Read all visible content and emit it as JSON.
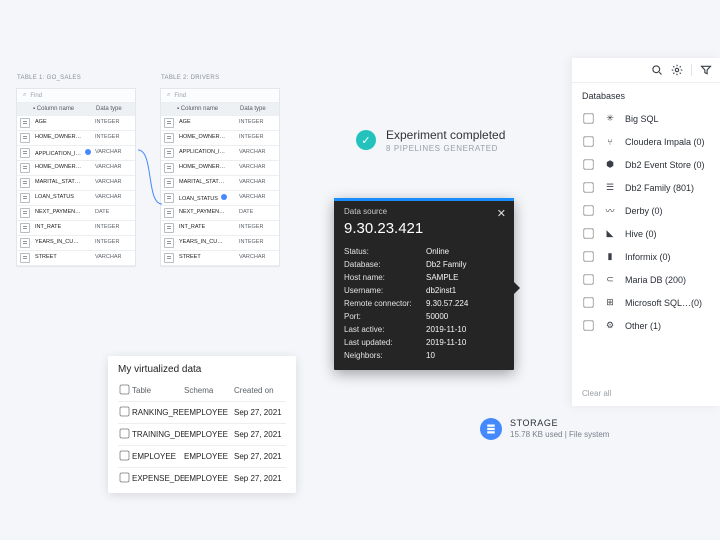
{
  "tables": [
    {
      "title": "Table 1: GO_SALES",
      "find_placeholder": "Find",
      "header": {
        "name": "Column name",
        "type": "Data type"
      },
      "columns": [
        {
          "n": "AGE",
          "t": "INTEGER"
        },
        {
          "n": "HOME_OWNER…",
          "t": "INTEGER"
        },
        {
          "n": "APPLICATION_I…",
          "t": "VARCHAR",
          "key": true
        },
        {
          "n": "HOME_OWNER…",
          "t": "VARCHAR"
        },
        {
          "n": "MARITAL_STAT…",
          "t": "VARCHAR"
        },
        {
          "n": "LOAN_STATUS",
          "t": "VARCHAR"
        },
        {
          "n": "NEXT_PAYMEN…",
          "t": "DATE"
        },
        {
          "n": "INT_RATE",
          "t": "INTEGER"
        },
        {
          "n": "YEARS_IN_CU…",
          "t": "INTEGER"
        },
        {
          "n": "STREET",
          "t": "VARCHAR"
        }
      ]
    },
    {
      "title": "Table 2: DRIVERS",
      "find_placeholder": "Find",
      "header": {
        "name": "Column name",
        "type": "Data type"
      },
      "columns": [
        {
          "n": "AGE",
          "t": "INTEGER"
        },
        {
          "n": "HOME_OWNER…",
          "t": "INTEGER"
        },
        {
          "n": "APPLICATION_I…",
          "t": "VARCHAR"
        },
        {
          "n": "HOME_OWNER…",
          "t": "VARCHAR"
        },
        {
          "n": "MARITAL_STAT…",
          "t": "VARCHAR"
        },
        {
          "n": "LOAN_STATUS",
          "t": "VARCHAR",
          "key": true
        },
        {
          "n": "NEXT_PAYMEN…",
          "t": "DATE"
        },
        {
          "n": "INT_RATE",
          "t": "INTEGER"
        },
        {
          "n": "YEARS_IN_CU…",
          "t": "INTEGER"
        },
        {
          "n": "STREET",
          "t": "VARCHAR"
        }
      ]
    }
  ],
  "experiment": {
    "title": "Experiment completed",
    "subtitle": "8 PIPELINES GENERATED"
  },
  "datasource": {
    "heading": "Data source",
    "ip": "9.30.23.421",
    "rows": [
      {
        "k": "Status:",
        "v": "Online"
      },
      {
        "k": "Database:",
        "v": "Db2 Family"
      },
      {
        "k": "Host name:",
        "v": "SAMPLE"
      },
      {
        "k": "Username:",
        "v": "db2inst1"
      },
      {
        "k": "Remote connector:",
        "v": "9.30.57.224"
      },
      {
        "k": "Port:",
        "v": "50000"
      },
      {
        "k": "Last active:",
        "v": "2019-11-10"
      },
      {
        "k": "Last updated:",
        "v": "2019-11-10"
      },
      {
        "k": "Neighbors:",
        "v": "10"
      }
    ]
  },
  "virtualized": {
    "title": "My virtualized data",
    "header": {
      "table": "Table",
      "schema": "Schema",
      "created": "Created on"
    },
    "rows": [
      {
        "t": "RANKING_RESULTS",
        "s": "EMPLOYEE",
        "c": "Sep 27, 2021"
      },
      {
        "t": "TRAINING_DETAILS",
        "s": "EMPLOYEE",
        "c": "Sep 27, 2021"
      },
      {
        "t": "EMPLOYEE",
        "s": "EMPLOYEE",
        "c": "Sep 27, 2021"
      },
      {
        "t": "EXPENSE_DETAIL",
        "s": "EMPLOYEE",
        "c": "Sep 27, 2021"
      }
    ]
  },
  "storage": {
    "title": "STORAGE",
    "sub": "15.78 KB used | File system"
  },
  "dbpanel": {
    "section": "Databases",
    "clear": "Clear all",
    "items": [
      {
        "label": "Big SQL"
      },
      {
        "label": "Cloudera Impala (0)"
      },
      {
        "label": "Db2 Event Store (0)"
      },
      {
        "label": "Db2 Family (801)"
      },
      {
        "label": "Derby (0)"
      },
      {
        "label": "Hive (0)"
      },
      {
        "label": "Informix (0)"
      },
      {
        "label": "Maria DB (200)"
      },
      {
        "label": "Microsoft SQL…(0)"
      },
      {
        "label": "Other (1)"
      }
    ]
  }
}
